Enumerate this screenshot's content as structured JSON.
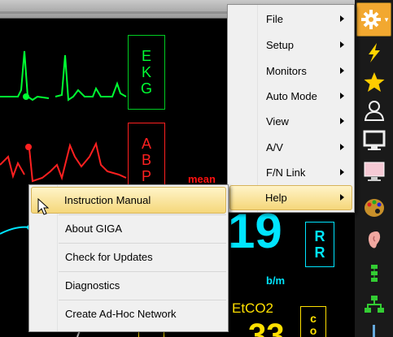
{
  "monitor": {
    "ekg_label": [
      "E",
      "K",
      "G"
    ],
    "abp_label": [
      "A",
      "B",
      "P"
    ],
    "mean_label": "mean",
    "rr_value": "19",
    "rr_label": [
      "R",
      "R"
    ],
    "rr_unit": "b/m",
    "etco2_label": "EtCO2",
    "etco2_value": "33",
    "co_label": [
      "c",
      "o"
    ]
  },
  "main_menu": {
    "items": [
      {
        "label": "File",
        "has_submenu": true
      },
      {
        "label": "Setup",
        "has_submenu": true
      },
      {
        "label": "Monitors",
        "has_submenu": true
      },
      {
        "label": "Auto Mode",
        "has_submenu": true
      },
      {
        "label": "View",
        "has_submenu": true
      },
      {
        "label": "A/V",
        "has_submenu": true
      },
      {
        "label": "F/N Link",
        "has_submenu": true
      },
      {
        "label": "Help",
        "has_submenu": true,
        "active": true
      }
    ]
  },
  "help_submenu": {
    "items": [
      {
        "label": "Instruction Manual",
        "active": true
      },
      {
        "label": "About GIGA"
      },
      {
        "label": "Check for Updates"
      },
      {
        "label": "Diagnostics"
      },
      {
        "label": "Create Ad-Hoc Network"
      }
    ]
  },
  "toolbar": {
    "icons": [
      "gear-icon",
      "lightning-icon",
      "star-icon",
      "person-icon",
      "monitor-icon",
      "pink-monitor-icon",
      "palette-icon",
      "ear-icon",
      "network-tree-icon",
      "network-icon",
      "misc-icon"
    ]
  },
  "colors": {
    "ekg": "#00ff33",
    "abp": "#ff2020",
    "rr": "#00e5ff",
    "menu_highlight": "#f5d77a"
  }
}
